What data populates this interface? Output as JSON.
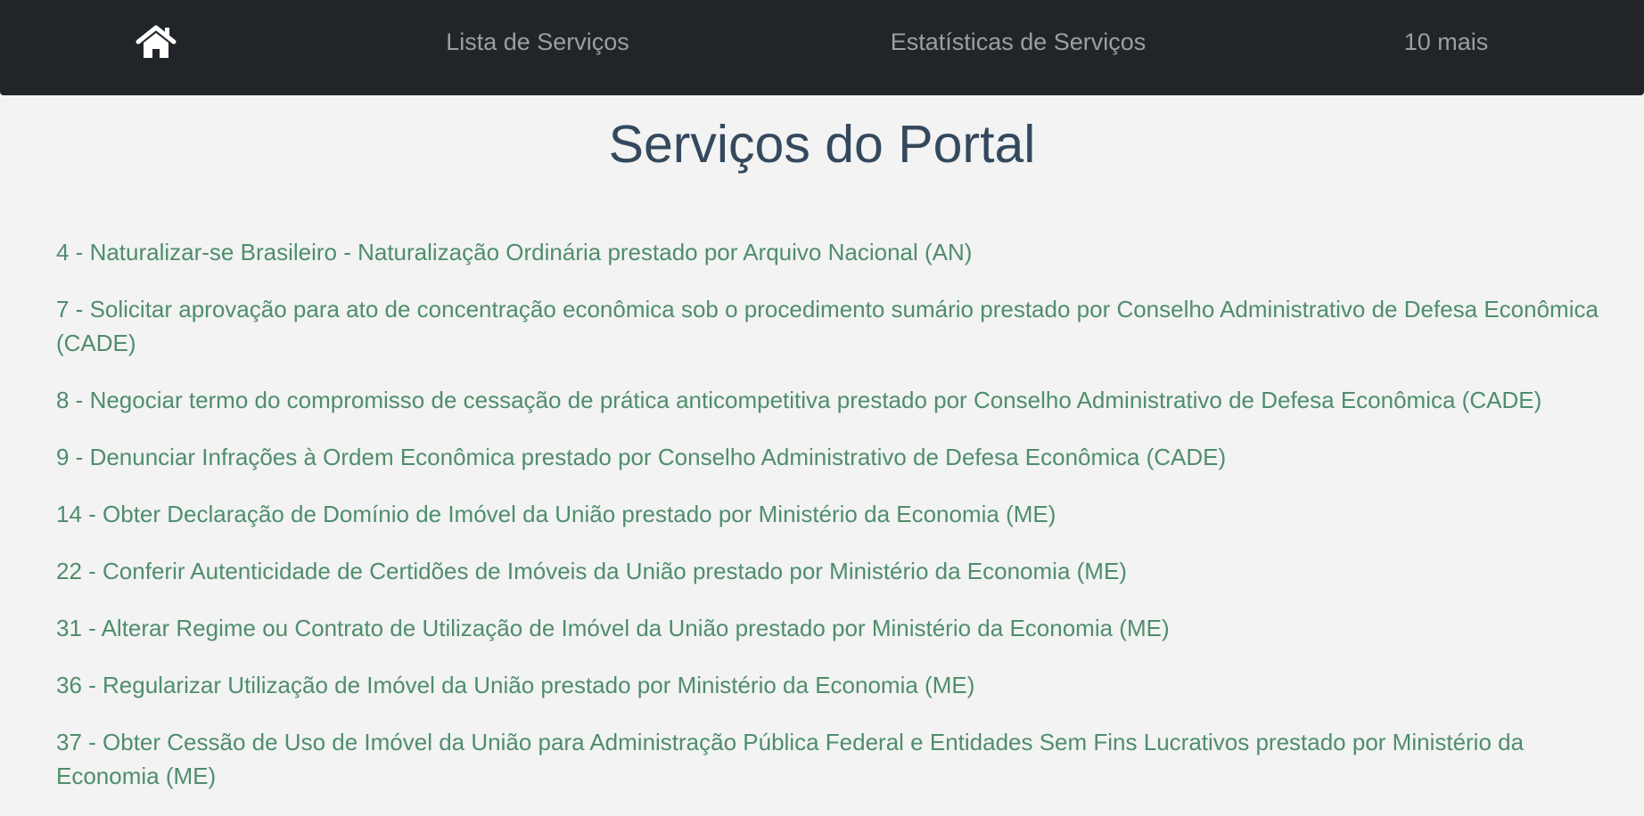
{
  "nav": {
    "home_icon": "home-icon",
    "items": [
      "Lista de Serviços",
      "Estatísticas de Serviços",
      "10 mais"
    ]
  },
  "page_title": "Serviços do Portal",
  "services": [
    "4 - Naturalizar-se Brasileiro - Naturalização Ordinária prestado por Arquivo Nacional (AN)",
    "7 - Solicitar aprovação para ato de concentração econômica sob o procedimento sumário prestado por Conselho Administrativo de Defesa Econômica (CADE)",
    "8 - Negociar termo do compromisso de cessação de prática anticompetitiva prestado por Conselho Administrativo de Defesa Econômica (CADE)",
    "9 - Denunciar Infrações à Ordem Econômica prestado por Conselho Administrativo de Defesa Econômica (CADE)",
    "14 - Obter Declaração de Domínio de Imóvel da União prestado por Ministério da Economia (ME)",
    "22 - Conferir Autenticidade de Certidões de Imóveis da União prestado por Ministério da Economia (ME)",
    "31 - Alterar Regime ou Contrato de Utilização de Imóvel da União prestado por Ministério da Economia (ME)",
    "36 - Regularizar Utilização de Imóvel da União prestado por Ministério da Economia (ME)",
    "37 - Obter Cessão de Uso de Imóvel da União para Administração Pública Federal e Entidades Sem Fins Lucrativos prestado por Ministério da Economia (ME)"
  ],
  "colors": {
    "nav_bg": "#212429",
    "title": "#34495e",
    "link": "#4f8d6d",
    "background": "#f2f3f2"
  }
}
